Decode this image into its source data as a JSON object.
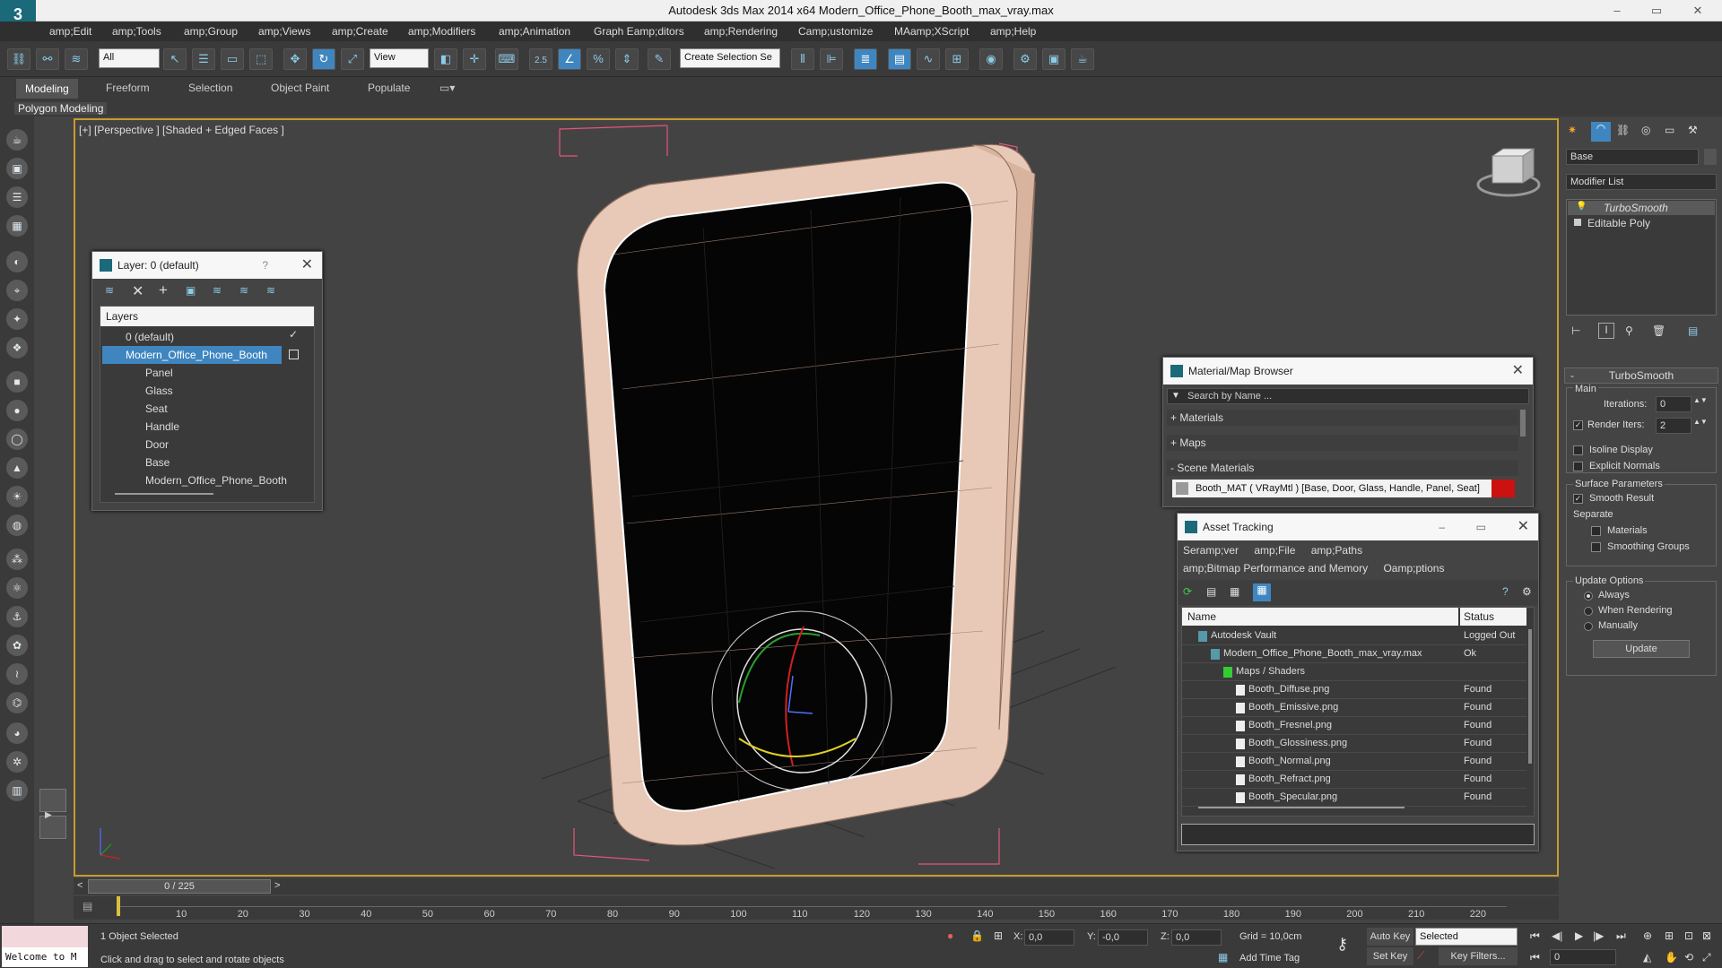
{
  "window": {
    "title": "Autodesk 3ds Max  2014 x64    Modern_Office_Phone_Booth_max_vray.max",
    "min": "–",
    "max": "▭",
    "close": "✕"
  },
  "menu": [
    "amp;Edit",
    "amp;Tools",
    "amp;Group",
    "amp;Views",
    "amp;Create",
    "amp;Modifiers",
    "amp;Animation",
    "Graph Eamp;ditors",
    "amp;Rendering",
    "Camp;ustomize",
    "MAamp;XScript",
    "amp;Help"
  ],
  "toolbar": {
    "filter": "All",
    "refcoord": "View",
    "snap_value": "2.5",
    "selection_set": "Create Selection Se"
  },
  "ribbon": {
    "tabs": [
      "Modeling",
      "Freeform",
      "Selection",
      "Object Paint",
      "Populate"
    ],
    "sub": "Polygon Modeling"
  },
  "viewport": {
    "label": "[+] [Perspective ] [Shaded + Edged Faces ]",
    "gizmo_axes": [
      "x",
      "y",
      "z"
    ]
  },
  "layer_window": {
    "title": "Layer: 0 (default)",
    "help": "?",
    "close": "✕",
    "header": "Layers",
    "rows": [
      "0 (default)",
      "Modern_Office_Phone_Booth",
      "Panel",
      "Glass",
      "Seat",
      "Handle",
      "Door",
      "Base",
      "Modern_Office_Phone_Booth"
    ]
  },
  "material_browser": {
    "title": "Material/Map Browser",
    "search": "Search by Name ...",
    "groups": [
      "+ Materials",
      "+ Maps",
      "- Scene Materials"
    ],
    "item": "Booth_MAT  ( VRayMtl )  [Base, Door, Glass, Handle, Panel, Seat]",
    "item_color": "#cc1111"
  },
  "asset_tracking": {
    "title": "Asset Tracking",
    "menu1": [
      "Seramp;ver",
      "amp;File",
      "amp;Paths"
    ],
    "menu2": [
      "amp;Bitmap Performance and Memory",
      "Oamp;ptions"
    ],
    "columns": [
      "Name",
      "Status"
    ],
    "rows": [
      {
        "name": "Autodesk Vault",
        "status": "Logged Out",
        "indent": 1
      },
      {
        "name": "Modern_Office_Phone_Booth_max_vray.max",
        "status": "Ok",
        "indent": 2
      },
      {
        "name": "Maps / Shaders",
        "status": "",
        "indent": 3
      },
      {
        "name": "Booth_Diffuse.png",
        "status": "Found",
        "indent": 4
      },
      {
        "name": "Booth_Emissive.png",
        "status": "Found",
        "indent": 4
      },
      {
        "name": "Booth_Fresnel.png",
        "status": "Found",
        "indent": 4
      },
      {
        "name": "Booth_Glossiness.png",
        "status": "Found",
        "indent": 4
      },
      {
        "name": "Booth_Normal.png",
        "status": "Found",
        "indent": 4
      },
      {
        "name": "Booth_Refract.png",
        "status": "Found",
        "indent": 4
      },
      {
        "name": "Booth_Specular.png",
        "status": "Found",
        "indent": 4
      }
    ]
  },
  "command_panel": {
    "object_name": "Base",
    "modifier_list": "Modifier List",
    "stack": [
      "TurboSmooth",
      "Editable Poly"
    ],
    "rollout": "TurboSmooth",
    "main": "Main",
    "iterations_label": "Iterations:",
    "iterations": "0",
    "render_iters_label": "Render Iters:",
    "render_iters": "2",
    "isoline": "Isoline Display",
    "explicit": "Explicit Normals",
    "surface": "Surface Parameters",
    "smooth": "Smooth Result",
    "separate": "Separate",
    "materials": "Materials",
    "smoothing": "Smoothing Groups",
    "update_options": "Update Options",
    "always": "Always",
    "when_rendering": "When Rendering",
    "manually": "Manually",
    "update": "Update"
  },
  "timeline": {
    "frame": "0 / 225",
    "ticks": [
      "10",
      "20",
      "30",
      "40",
      "50",
      "60",
      "70",
      "80",
      "90",
      "100",
      "110",
      "120",
      "130",
      "140",
      "150",
      "160",
      "170",
      "180",
      "190",
      "200",
      "210",
      "220"
    ]
  },
  "status": {
    "welcome": "Welcome to M",
    "selected": "1 Object Selected",
    "prompt": "Click and drag to select and rotate objects",
    "x_label": "X:",
    "x": "0,0",
    "y_label": "Y:",
    "y": "-0,0",
    "z_label": "Z:",
    "z": "0,0",
    "grid": "Grid = 10,0cm",
    "add_time_tag": "Add Time Tag",
    "auto_key": "Auto Key",
    "set_key": "Set Key",
    "selected_mode": "Selected",
    "key_filters": "Key Filters...",
    "frame": "0"
  }
}
